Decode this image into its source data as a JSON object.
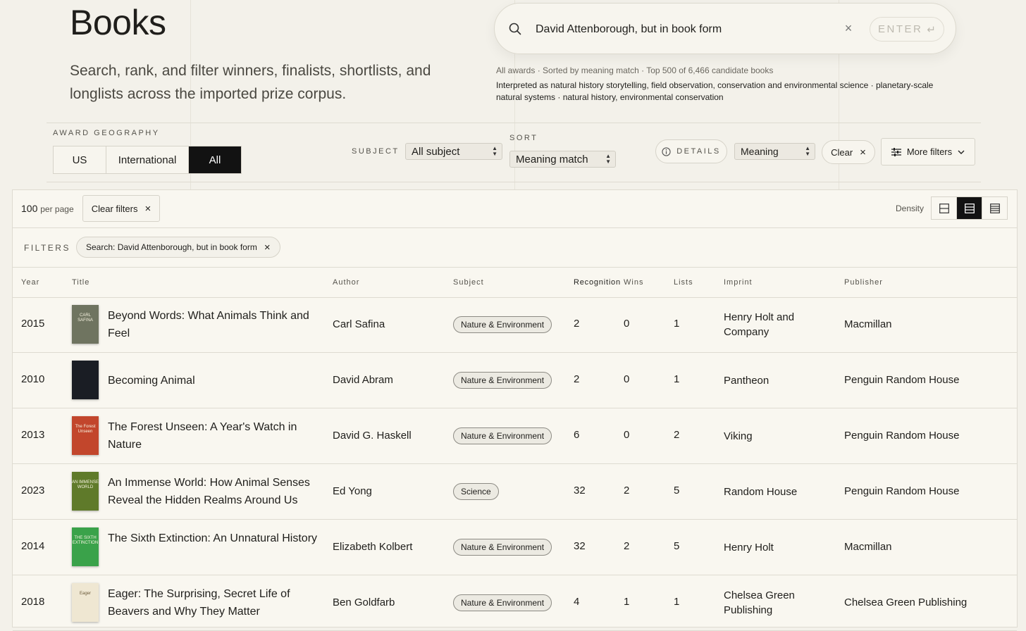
{
  "header": {
    "title": "Books",
    "subtitle": "Search, rank, and filter winners, finalists, shortlists, and longlists across the imported prize corpus."
  },
  "search": {
    "value": "David Attenborough, but in book form",
    "enter_label": "ENTER",
    "enter_glyph": "↵",
    "clear_glyph": "×"
  },
  "meta": {
    "summary": "All awards · Sorted by meaning match · Top 500 of 6,466 candidate books",
    "interpretation": "Interpreted as natural history storytelling, field observation, conservation and environmental science · planetary-scale natural systems · natural history, environmental conservation"
  },
  "filters_bar": {
    "geography_label": "AWARD GEOGRAPHY",
    "geography_options": [
      "US",
      "International",
      "All"
    ],
    "geography_selected": "All",
    "subject_label": "SUBJECT",
    "subject_value": "All subject",
    "sort_label": "SORT",
    "sort_value": "Meaning match",
    "details_label": "DETAILS",
    "meaning_value": "Meaning",
    "clear_label": "Clear",
    "more_filters_label": "More filters"
  },
  "toolbar": {
    "per_page_value": "100",
    "per_page_suffix": "per page",
    "clear_filters_label": "Clear filters",
    "density_label": "Density",
    "density_selected": "medium"
  },
  "active_filters": {
    "label": "FILTERS",
    "chips": [
      "Search: David Attenborough, but in book form"
    ]
  },
  "table": {
    "columns": [
      "Year",
      "Title",
      "Author",
      "Subject",
      "Recognition",
      "Wins",
      "Lists",
      "Imprint",
      "Publisher"
    ],
    "rows": [
      {
        "year": "2015",
        "title": "Beyond Words: What Animals Think and Feel",
        "author": "Carl Safina",
        "subject": "Nature & Environment",
        "recognition": "2",
        "wins": "0",
        "lists": "1",
        "imprint": "Henry Holt and Company",
        "publisher": "Macmillan",
        "cover_color": "#6f7460",
        "cover_text": "CARL SAFINA"
      },
      {
        "year": "2010",
        "title": "Becoming Animal",
        "author": "David Abram",
        "subject": "Nature & Environment",
        "recognition": "2",
        "wins": "0",
        "lists": "1",
        "imprint": "Pantheon",
        "publisher": "Penguin Random House",
        "cover_color": "#1a1d24",
        "cover_text": ""
      },
      {
        "year": "2013",
        "title": "The Forest Unseen: A Year's Watch in Nature",
        "author": "David G. Haskell",
        "subject": "Nature & Environment",
        "recognition": "6",
        "wins": "0",
        "lists": "2",
        "imprint": "Viking",
        "publisher": "Penguin Random House",
        "cover_color": "#c2462c",
        "cover_text": "The Forest Unseen"
      },
      {
        "year": "2023",
        "title": "An Immense World: How Animal Senses Reveal the Hidden Realms Around Us",
        "author": "Ed Yong",
        "subject": "Science",
        "recognition": "32",
        "wins": "2",
        "lists": "5",
        "imprint": "Random House",
        "publisher": "Penguin Random House",
        "cover_color": "#5f7a2a",
        "cover_text": "AN IMMENSE WORLD"
      },
      {
        "year": "2014",
        "title": "The Sixth Extinction: An Unnatural History",
        "author": "Elizabeth Kolbert",
        "subject": "Nature & Environment",
        "recognition": "32",
        "wins": "2",
        "lists": "5",
        "imprint": "Henry Holt",
        "publisher": "Macmillan",
        "cover_color": "#3aa24a",
        "cover_text": "THE SIXTH EXTINCTION"
      },
      {
        "year": "2018",
        "title": "Eager: The Surprising, Secret Life of Beavers and Why They Matter",
        "author": "Ben Goldfarb",
        "subject": "Nature & Environment",
        "recognition": "4",
        "wins": "1",
        "lists": "1",
        "imprint": "Chelsea Green Publishing",
        "publisher": "Chelsea Green Publishing",
        "cover_color": "#efe7d2",
        "cover_text": "Eager"
      }
    ]
  },
  "colors": {
    "background": "#f3f1ea",
    "panel": "#f9f7f0",
    "selected": "#121212",
    "border": "#dedbd1"
  }
}
